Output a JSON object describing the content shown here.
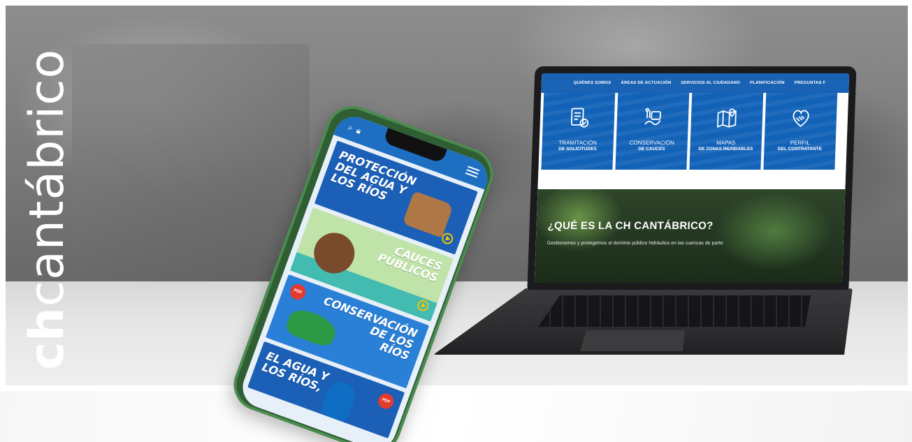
{
  "brand": {
    "prefix": "ch",
    "suffix": "cantábrico"
  },
  "laptop": {
    "nav": [
      "QUIÉNES SOMOS",
      "ÁREAS DE ACTUACIÓN",
      "SERVICIOS AL CIUDADANO",
      "PLANIFICACIÓN",
      "PREGUNTAS F"
    ],
    "tiles": [
      {
        "label": "TRAMITACIÓN",
        "sub": "DE SOLICITUDES",
        "icon": "document-check-icon"
      },
      {
        "label": "CONSERVACIÓN",
        "sub": "DE CAUCES",
        "icon": "river-tools-icon"
      },
      {
        "label": "MAPAS",
        "sub": "DE ZONAS INUNDABLES",
        "icon": "map-pin-icon"
      },
      {
        "label": "PERFIL",
        "sub": "DEL CONTRATANTE",
        "icon": "handshake-heart-icon"
      }
    ],
    "hero_title": "¿QUÉ ES LA CH CANTÁBRICO?",
    "hero_text": "Gestionamos y protegemos el dominio público hidráulico en las cuencas de parte"
  },
  "phone": {
    "cards": [
      {
        "title": "PROTECCIÓN\nDEL AGUA Y\nLOS RÍOS"
      },
      {
        "title": "CAUCES\nPÚBLICOS"
      },
      {
        "title": "CONSERVACIÓN\nDE LOS\nRÍOS",
        "badge": "PDF"
      },
      {
        "title": "EL AGUA Y\nLOS RÍOS,",
        "badge": "PDF"
      }
    ]
  },
  "colors": {
    "brand_blue": "#1a63b4",
    "phone_green": "#2f5e34",
    "accent_yellow": "#f5c400",
    "pdf_red": "#e23b2e"
  }
}
